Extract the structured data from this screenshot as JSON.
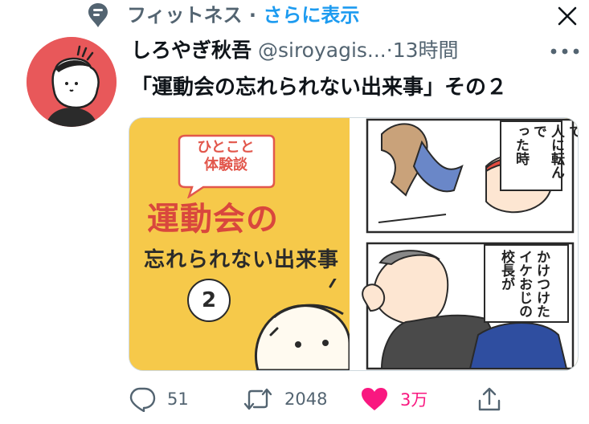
{
  "context": {
    "label": "フィットネス · ",
    "link": "さらに表示",
    "icon": "topic-bubble-icon"
  },
  "close_icon": "close-icon",
  "tweet": {
    "display_name": "しろやぎ秋吾",
    "handle": "@siroyagis...",
    "separator": "·",
    "time": "13時間",
    "more_icon": "more-icon",
    "text": "「運動会の忘れられない出来事」その２"
  },
  "media": {
    "left": {
      "badge": "ひとこと\n体験談",
      "title_line1": "運動会の",
      "title_line2": "忘れられない出来事",
      "number": "2"
    },
    "right": {
      "top_caption": "とくじいて\n人に転んで\nった時",
      "bottom_caption": "かけつけた\nイケおじの\n校長が"
    }
  },
  "actions": {
    "reply": {
      "icon": "reply-icon",
      "count": "51"
    },
    "retweet": {
      "icon": "retweet-icon",
      "count": "2048"
    },
    "like": {
      "icon": "heart-icon",
      "count": "3万",
      "color": "#f91880"
    },
    "share": {
      "icon": "share-icon"
    }
  },
  "colors": {
    "accent": "#1d9bf0",
    "muted": "#536471",
    "like": "#f91880",
    "avatar_bg": "#e8585a",
    "media_bg": "#f6c94a"
  }
}
